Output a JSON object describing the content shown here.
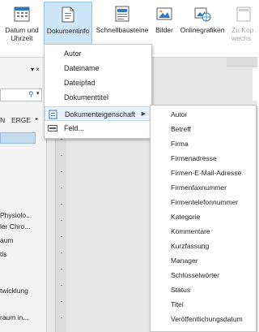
{
  "ribbon": {
    "buttons": [
      {
        "label": "Datum und Uhrzeit",
        "icon": "calendar-icon"
      },
      {
        "label": "Dokumentinfo",
        "icon": "document-info-icon",
        "active": true
      },
      {
        "label": "Schnellbausteine",
        "icon": "quick-parts-icon"
      },
      {
        "label": "Bilder",
        "icon": "pictures-icon"
      },
      {
        "label": "Onlinegrafiken",
        "icon": "online-pictures-icon"
      },
      {
        "label": "Zu Kop wechs",
        "icon": "go-to-header-icon",
        "disabled": true
      }
    ]
  },
  "nav": {
    "search_icon": "search-icon",
    "tab_label": "ERGE",
    "tab_left": "N",
    "items": [
      "Physiolo...",
      "ler Chro...",
      "aum",
      "tis",
      "twicklung",
      "raum in..."
    ]
  },
  "menu": {
    "items": [
      {
        "label": "Autor"
      },
      {
        "label": "Dateiname"
      },
      {
        "label": "Dateipfad"
      },
      {
        "label": "Dokumenttitel"
      },
      {
        "label": "Dokumenteigenschaft",
        "icon": "document-property-icon",
        "submenu": true
      },
      {
        "label": "Feld...",
        "icon": "field-icon"
      }
    ]
  },
  "submenu": {
    "items": [
      "Autor",
      "Betreff",
      "Firma",
      "Firmenadresse",
      "Firmen-E-Mail-Adresse",
      "Firmenfaxnummer",
      "Firmentelefonnummer",
      "Kategorie",
      "Kommentare",
      "Kurzfassung",
      "Manager",
      "Schlüsselwörter",
      "Status",
      "Titel",
      "Veröffentlichungsdatum"
    ]
  },
  "colors": {
    "active_button": "#cde6f7",
    "menu_highlight": "#e6f1fb",
    "selection_blue": "#c5dcf0"
  }
}
